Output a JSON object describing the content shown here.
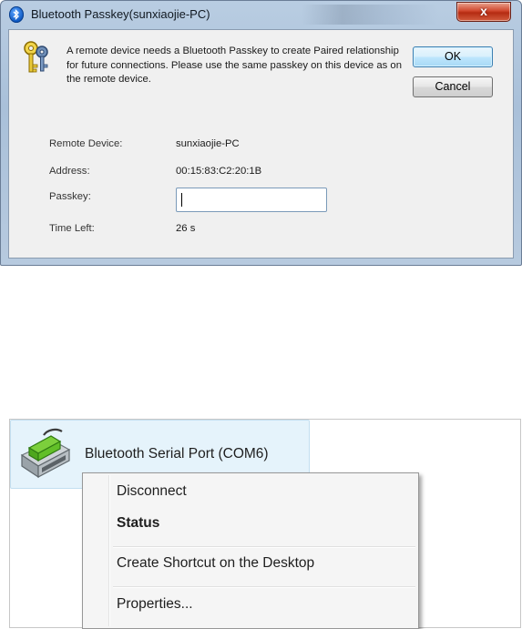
{
  "dialog": {
    "title": "Bluetooth Passkey(sunxiaojie-PC)",
    "close_label": "x",
    "message": "A remote device needs a Bluetooth Passkey to create Paired relationship for future connections. Please use the same passkey on this device as on the remote device.",
    "ok_label": "OK",
    "cancel_label": "Cancel",
    "fields": {
      "remote_device_label": "Remote Device:",
      "remote_device_value": "sunxiaojie-PC",
      "address_label": "Address:",
      "address_value": "00:15:83:C2:20:1B",
      "passkey_label": "Passkey:",
      "passkey_value": "",
      "time_left_label": "Time Left:",
      "time_left_value": "26 s"
    }
  },
  "device": {
    "name": "Bluetooth Serial Port (COM6)",
    "icon": "serial-port-icon"
  },
  "context_menu": {
    "items": [
      "Disconnect",
      "Status",
      "Create Shortcut on the Desktop",
      "Properties..."
    ],
    "default_item": "Status"
  },
  "colors": {
    "close_button": "#d0462c",
    "ok_button_border": "#3c7fb1",
    "tile_highlight": "#e5f3fb"
  }
}
